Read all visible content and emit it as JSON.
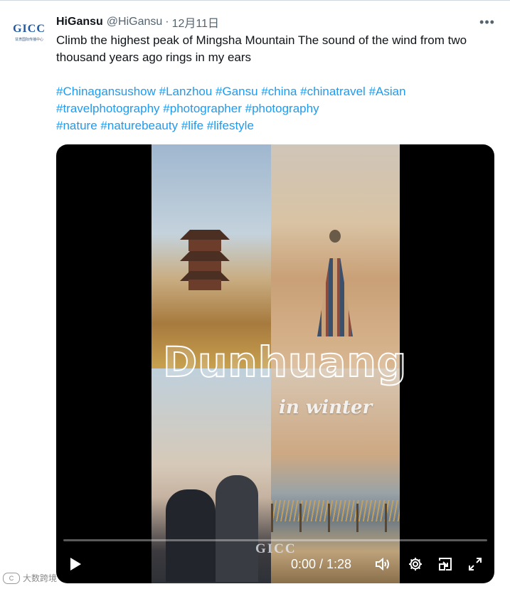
{
  "tweet": {
    "avatar_logo": "GICC",
    "avatar_subtitle": "甘肃国际传播中心",
    "display_name": "HiGansu",
    "handle": "@HiGansu",
    "separator": "·",
    "date": "12月11日",
    "more_icon": "more-horizontal-icon",
    "text": "Climb the highest peak of Mingsha Mountain The sound of the wind from two thousand years ago rings in my ears",
    "hashtags": [
      "#Chinagansushow",
      "#Lanzhou",
      "#Gansu",
      "#china",
      "#chinatravel",
      "#Asian",
      "#travelphotography",
      "#photographer",
      "#photography",
      "#nature",
      "#naturebeauty",
      "#life",
      "#lifestyle"
    ]
  },
  "video": {
    "overlay_title": "Dunhuang",
    "overlay_subtitle": "in winter",
    "watermark": "GICC",
    "time": "0:00 / 1:28",
    "progress": 0,
    "controls": [
      "play-icon",
      "volume-icon",
      "settings-gear-icon",
      "pip-icon",
      "fullscreen-icon"
    ]
  },
  "page_watermark": "大数跨境",
  "colors": {
    "accent": "#1d9bf0",
    "text": "#0f1419",
    "muted": "#536471",
    "video_bg": "#000000"
  }
}
